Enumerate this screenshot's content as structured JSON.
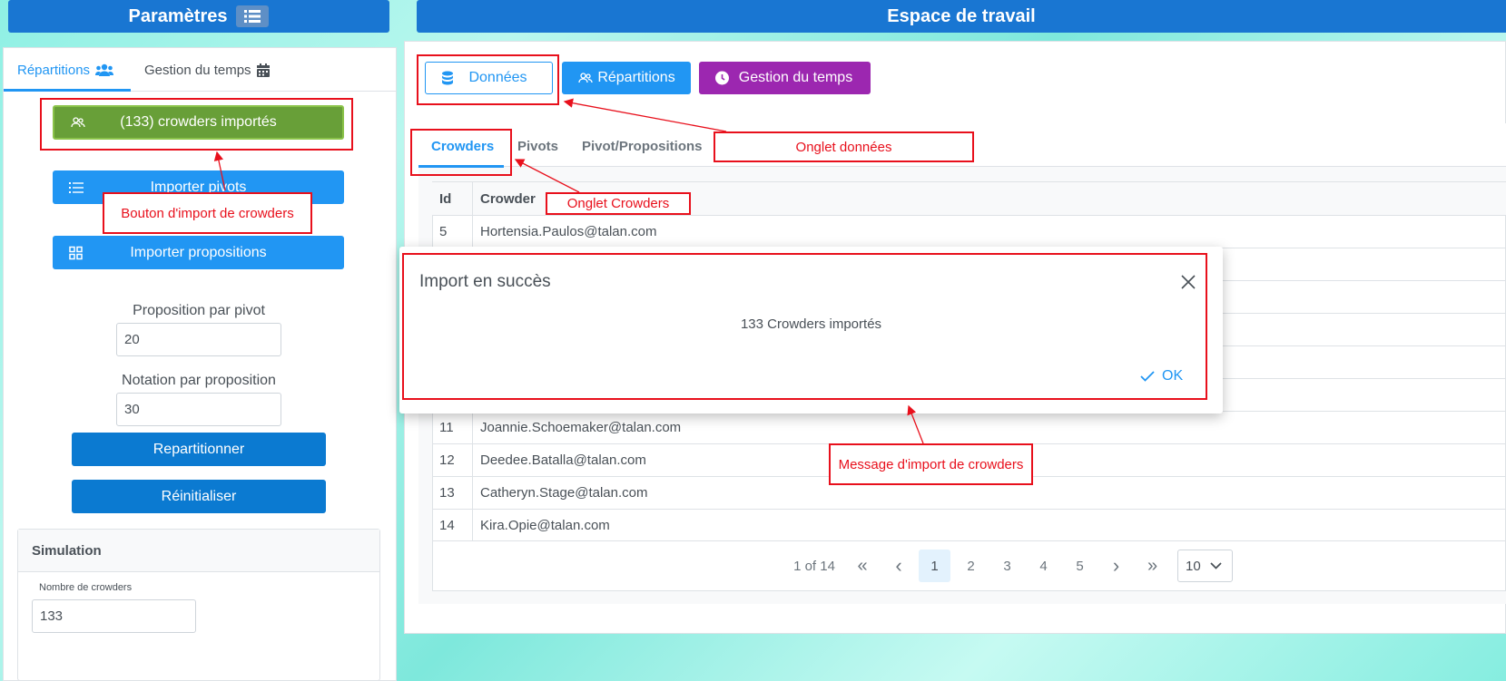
{
  "left": {
    "header_title": "Paramètres",
    "tabs": [
      {
        "label": "Répartitions"
      },
      {
        "label": "Gestion du temps"
      }
    ],
    "buttons": {
      "crowders": "(133) crowders importés",
      "pivots": "Importer pivots",
      "propositions": "Importer propositions",
      "repartitionner": "Repartitionner",
      "reinitialiser": "Réinitialiser"
    },
    "fields": {
      "prop_label": "Proposition par pivot",
      "prop_value": "20",
      "notation_label": "Notation par proposition",
      "notation_value": "30"
    },
    "simulation": {
      "title": "Simulation",
      "nb_label": "Nombre de crowders",
      "nb_value": "133"
    }
  },
  "workspace": {
    "header_title": "Espace de travail",
    "buttons": {
      "donnees": "Données",
      "repartitions": "Répartitions",
      "gestion": "Gestion du temps"
    },
    "tabs": [
      {
        "label": "Crowders"
      },
      {
        "label": "Pivots"
      },
      {
        "label": "Pivot/Propositions"
      }
    ],
    "table": {
      "headers": [
        "Id",
        "Crowder"
      ],
      "top_row": {
        "id": "5",
        "crowder": "Hortensia.Paulos@talan.com"
      },
      "rows": [
        {
          "id": "11",
          "crowder": "Joannie.Schoemaker@talan.com"
        },
        {
          "id": "12",
          "crowder": "Deedee.Batalla@talan.com"
        },
        {
          "id": "13",
          "crowder": "Catheryn.Stage@talan.com"
        },
        {
          "id": "14",
          "crowder": "Kira.Opie@talan.com"
        }
      ]
    },
    "pager": {
      "info": "1 of 14",
      "first": "«",
      "prev": "‹",
      "pages": [
        "1",
        "2",
        "3",
        "4",
        "5"
      ],
      "next": "›",
      "last": "»",
      "per_page": "10",
      "current_page": 1
    }
  },
  "dialog": {
    "title": "Import en succès",
    "message": "133 Crowders importés",
    "ok_label": "OK",
    "close": "×"
  },
  "annotations": {
    "bouton_import": "Bouton d'import de crowders",
    "onglet_donnees": "Onglet données",
    "onglet_crowders": "Onglet Crowders",
    "message_import": "Message d'import de crowders"
  },
  "colors": {
    "header_blue": "#1976d2",
    "button_blue": "#2196f3",
    "button_dark_blue": "#0b7ad1",
    "success_green": "#689f38",
    "purple": "#9c27b0",
    "annotation_red": "#e8101c"
  }
}
